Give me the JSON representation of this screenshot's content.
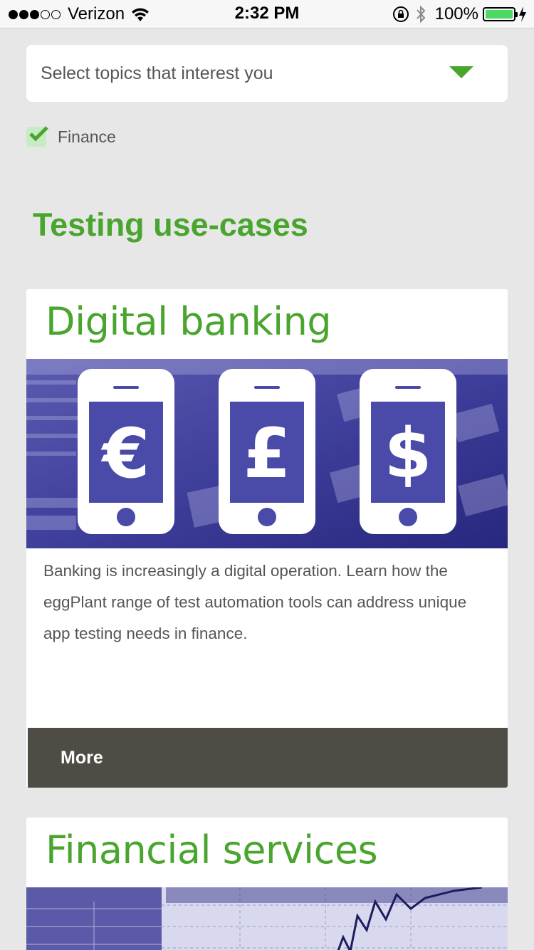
{
  "status_bar": {
    "carrier": "Verizon",
    "time": "2:32 PM",
    "battery_percent": "100%",
    "signal_bars_filled": 3,
    "signal_bars_total": 5
  },
  "filter": {
    "dropdown_label": "Select topics that interest you",
    "selected_topics": [
      {
        "label": "Finance",
        "checked": true
      }
    ]
  },
  "section": {
    "title": "Testing use-cases"
  },
  "cards": [
    {
      "title": "Digital banking",
      "description": "Banking is increasingly a digital operation. Learn how the eggPlant range of test automation tools can address unique app testing needs in finance.",
      "image_symbols": [
        "€",
        "£",
        "$"
      ],
      "more_label": "More"
    },
    {
      "title": "Financial services"
    }
  ],
  "colors": {
    "accent_green": "#4aa52e",
    "background": "#e8e7e8",
    "button_dark": "#4e4c45",
    "image_blue": "#34349a"
  }
}
